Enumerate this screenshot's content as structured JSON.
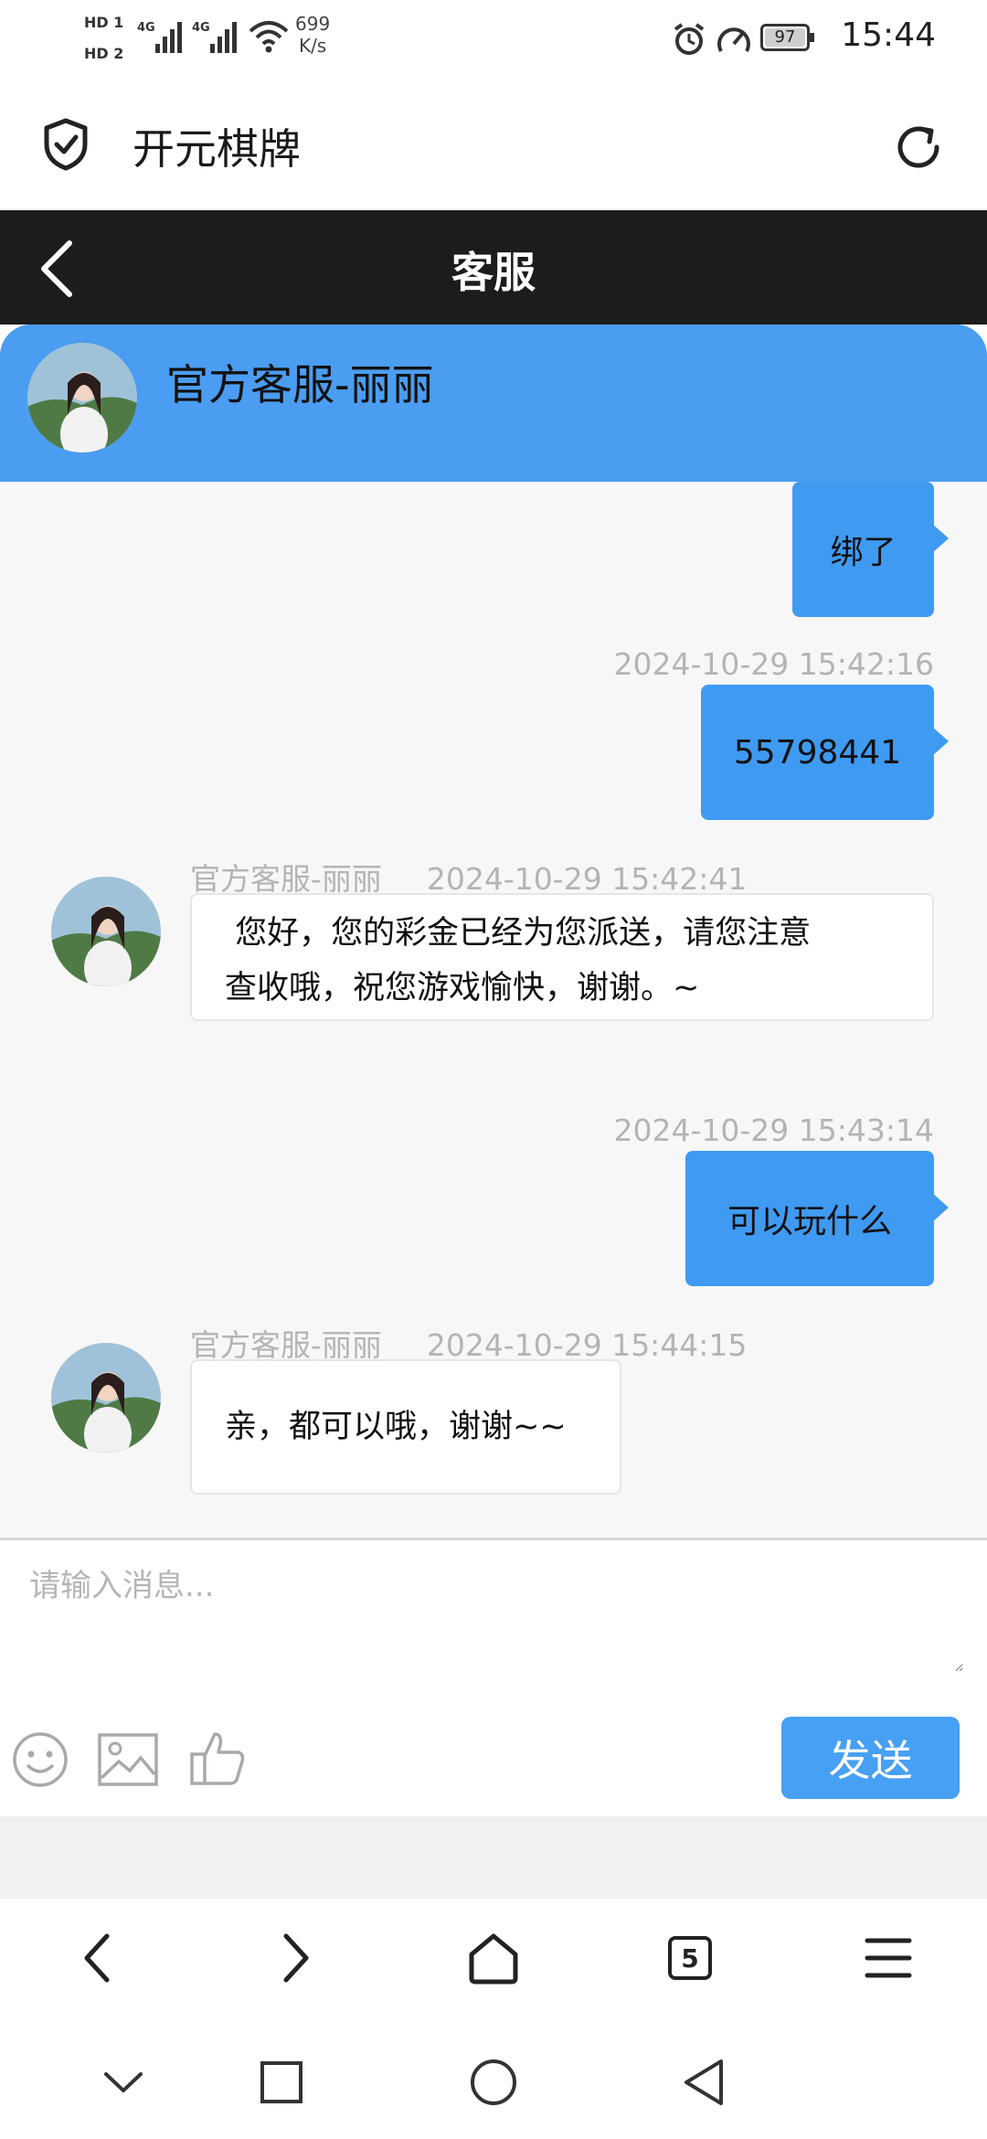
{
  "status_bar": {
    "sim1": "HD 1",
    "sim2": "HD 2",
    "network1": "4G",
    "network2": "4G",
    "speed_value": "699",
    "speed_unit": "K/s",
    "battery": "97",
    "time": "15:44"
  },
  "browser": {
    "site_title": "开元棋牌",
    "tab_count": "5"
  },
  "page": {
    "title": "客服"
  },
  "agent": {
    "name": "官方客服-丽丽"
  },
  "messages": [
    {
      "direction": "out",
      "text": "绑了"
    },
    {
      "direction": "out",
      "timestamp": "2024-10-29 15:42:16",
      "text": "55798441"
    },
    {
      "direction": "in",
      "sender": "官方客服-丽丽",
      "timestamp": "2024-10-29 15:42:41",
      "text_line1": " 您好，您的彩金已经为您派送，请您注意",
      "text_line2": "查收哦，祝您游戏愉快，谢谢。~"
    },
    {
      "direction": "out",
      "timestamp": "2024-10-29 15:43:14",
      "text": "可以玩什么"
    },
    {
      "direction": "in",
      "sender": "官方客服-丽丽",
      "timestamp": "2024-10-29 15:44:15",
      "text": "亲，都可以哦，谢谢~~"
    }
  ],
  "composer": {
    "placeholder": "请输入消息...",
    "send_label": "发送",
    "tools": [
      "emoji-icon",
      "image-icon",
      "thumbs-up-icon"
    ]
  },
  "colors": {
    "header_dark": "#1c1c1c",
    "agent_header": "#4a9df0",
    "bubble_out": "#3f9af2",
    "send_button": "#46a0f4"
  }
}
